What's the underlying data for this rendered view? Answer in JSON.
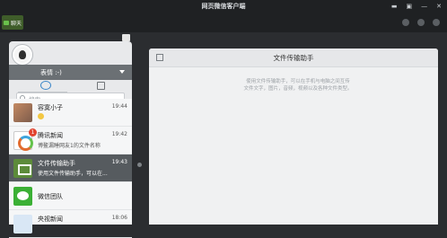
{
  "window": {
    "title": "网页微信客户端"
  },
  "toolbar": {
    "chat_label": "聊天"
  },
  "profile": {
    "status": "表情 :-)"
  },
  "search": {
    "placeholder": "搜索"
  },
  "conversations": [
    {
      "name": "容寞小子",
      "preview": "",
      "time": "19:44",
      "badge": "",
      "selected": false
    },
    {
      "name": "腾讯新闻",
      "preview": "博鳌漏睡网友1的文件名称",
      "time": "19:42",
      "badge": "1",
      "selected": false
    },
    {
      "name": "文件传输助手",
      "preview": "使用文件传输助手，可以在...",
      "time": "19:43",
      "badge": "",
      "selected": true
    },
    {
      "name": "微信团队",
      "preview": "",
      "time": "",
      "badge": "",
      "selected": false
    },
    {
      "name": "央视新闻",
      "preview": "",
      "time": "18:06",
      "badge": "",
      "selected": false
    }
  ],
  "chat": {
    "title": "文件传输助手",
    "notice_line1": "使用文件传输助手，可以在手机与电脑之间互传",
    "notice_line2": "文件文字，图片，音频，视频以及各种文件类型。"
  },
  "colors": {
    "selected_row": "#565b5f",
    "accent_green": "#6ac24c",
    "badge_red": "#e2442f"
  }
}
